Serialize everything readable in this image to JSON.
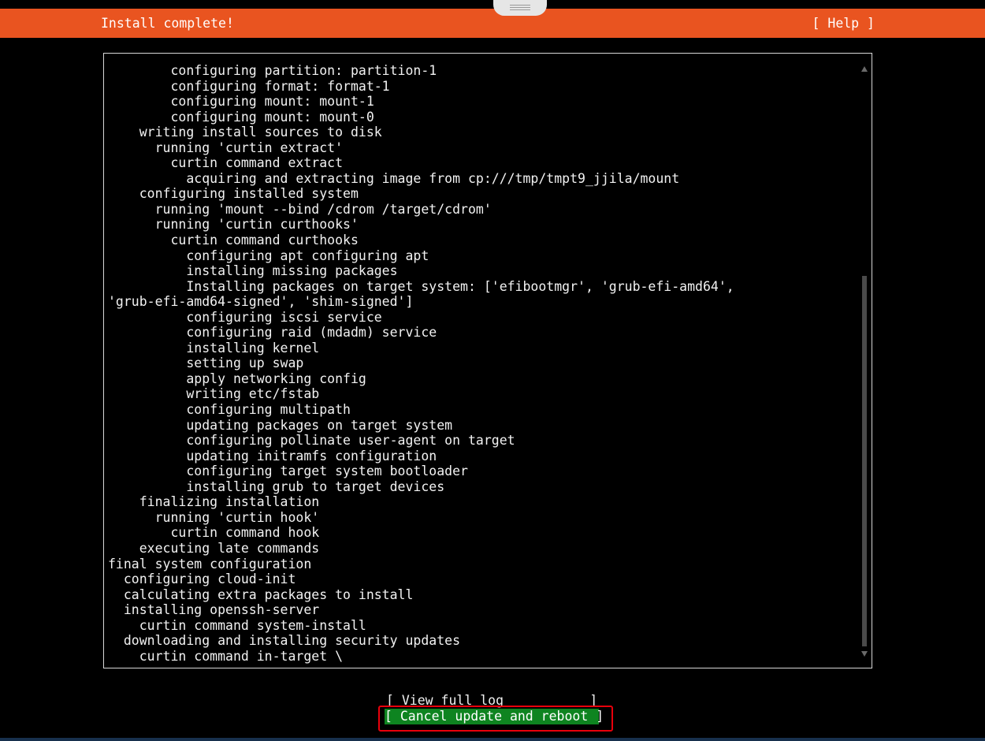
{
  "header": {
    "title": "Install complete!",
    "help_label": "[ Help ]"
  },
  "log": {
    "lines": [
      "        configuring partition: partition-1",
      "        configuring format: format-1",
      "        configuring mount: mount-1",
      "        configuring mount: mount-0",
      "    writing install sources to disk",
      "      running 'curtin extract'",
      "        curtin command extract",
      "          acquiring and extracting image from cp:///tmp/tmpt9_jjila/mount",
      "    configuring installed system",
      "      running 'mount --bind /cdrom /target/cdrom'",
      "      running 'curtin curthooks'",
      "        curtin command curthooks",
      "          configuring apt configuring apt",
      "          installing missing packages",
      "          Installing packages on target system: ['efibootmgr', 'grub-efi-amd64',",
      "'grub-efi-amd64-signed', 'shim-signed']",
      "          configuring iscsi service",
      "          configuring raid (mdadm) service",
      "          installing kernel",
      "          setting up swap",
      "          apply networking config",
      "          writing etc/fstab",
      "          configuring multipath",
      "          updating packages on target system",
      "          configuring pollinate user-agent on target",
      "          updating initramfs configuration",
      "          configuring target system bootloader",
      "          installing grub to target devices",
      "    finalizing installation",
      "      running 'curtin hook'",
      "        curtin command hook",
      "    executing late commands",
      "final system configuration",
      "  configuring cloud-init",
      "  calculating extra packages to install",
      "  installing openssh-server",
      "    curtin command system-install",
      "  downloading and installing security updates",
      "    curtin command in-target \\"
    ]
  },
  "buttons": {
    "view_full_log": "[ View full log           ]",
    "cancel_update_reboot": "[ Cancel update and reboot ]"
  },
  "colors": {
    "header_bg": "#e95420",
    "selected_button_bg": "#0e8420",
    "highlight_border": "#e8000b"
  }
}
